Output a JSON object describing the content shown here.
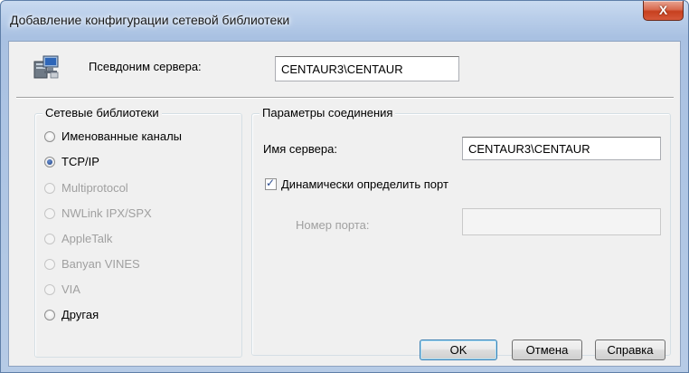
{
  "window": {
    "title": "Добавление конфигурации сетевой библиотеки",
    "close_glyph": "X"
  },
  "alias": {
    "label": "Псевдоним сервера:",
    "value": "CENTAUR3\\CENTAUR"
  },
  "libraries": {
    "title": "Сетевые библиотеки",
    "items": [
      {
        "label": "Именованные каналы",
        "checked": false,
        "enabled": true
      },
      {
        "label": "TCP/IP",
        "checked": true,
        "enabled": true
      },
      {
        "label": "Multiprotocol",
        "checked": false,
        "enabled": false
      },
      {
        "label": "NWLink IPX/SPX",
        "checked": false,
        "enabled": false
      },
      {
        "label": "AppleTalk",
        "checked": false,
        "enabled": false
      },
      {
        "label": "Banyan VINES",
        "checked": false,
        "enabled": false
      },
      {
        "label": "VIA",
        "checked": false,
        "enabled": false
      },
      {
        "label": "Другая",
        "checked": false,
        "enabled": true
      }
    ]
  },
  "connection": {
    "title": "Параметры соединения",
    "server_name_label": "Имя сервера:",
    "server_name_value": "CENTAUR3\\CENTAUR",
    "dynamic_port_label": "Динамически определить порт",
    "dynamic_port_checked": true,
    "port_label": "Номер порта:",
    "port_value": ""
  },
  "buttons": {
    "ok": "OK",
    "cancel": "Отмена",
    "help": "Справка"
  },
  "icons": {
    "server": "server-computer-icon",
    "close": "close-icon",
    "check": "checkmark-icon"
  }
}
